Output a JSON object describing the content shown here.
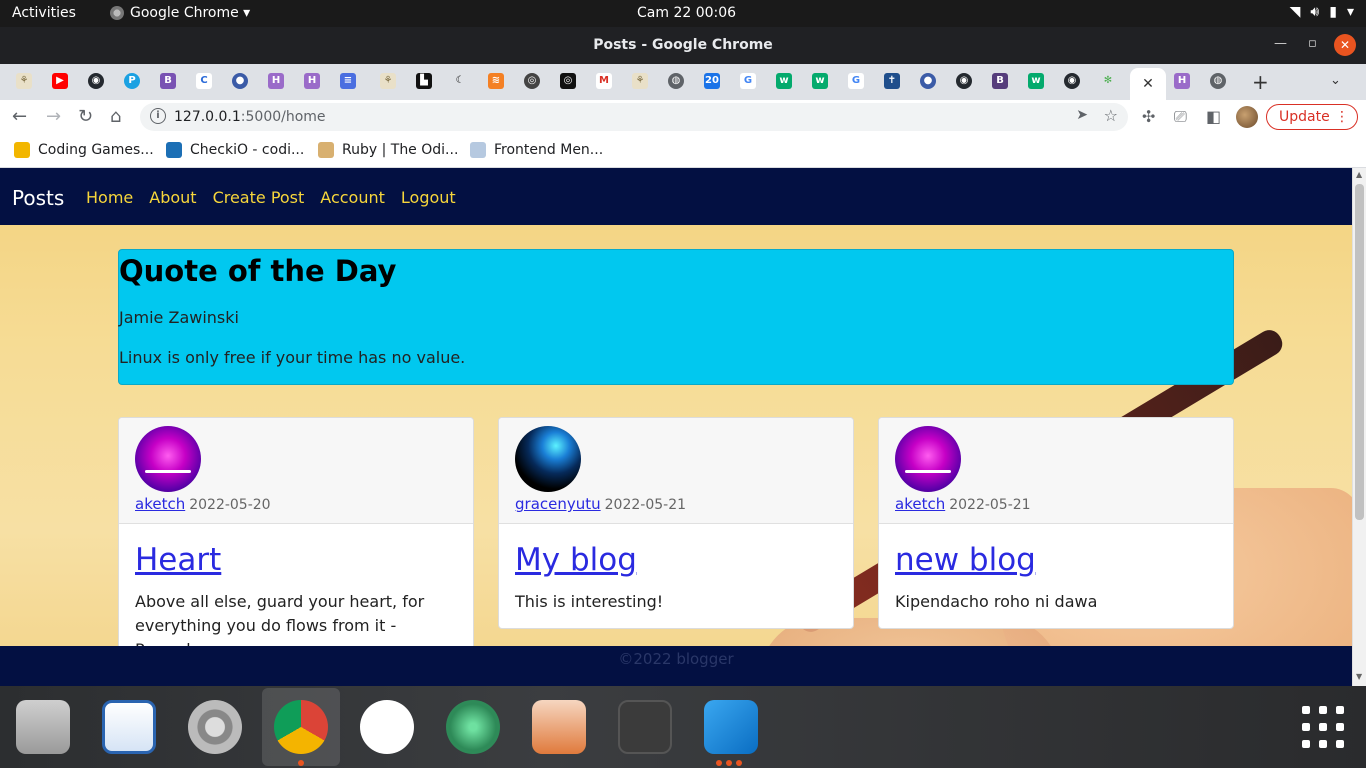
{
  "topbar": {
    "activities": "Activities",
    "app_name": "Google Chrome ▾",
    "clock": "Cam 22  00:06"
  },
  "window": {
    "title": "Posts - Google Chrome"
  },
  "address_bar": {
    "url_host": "127.0.0.1",
    "url_rest": ":5000/home",
    "update_label": "Update"
  },
  "bookmarks": [
    {
      "label": "Coding Games...",
      "color": "#f2b600"
    },
    {
      "label": "CheckiO - codi...",
      "color": "#1c6fb5"
    },
    {
      "label": "Ruby | The Odi...",
      "color": "#d8b070"
    },
    {
      "label": "Frontend Men...",
      "color": "#b6c9e0"
    }
  ],
  "page": {
    "brand": "Posts",
    "nav": [
      "Home",
      "About",
      "Create Post",
      "Account",
      "Logout"
    ],
    "quote": {
      "heading": "Quote of the Day",
      "author": "Jamie Zawinski",
      "text": "Linux is only free if your time has no value."
    },
    "posts": [
      {
        "user": "aketch",
        "date": "2022-05-20",
        "title": "Heart",
        "content": "Above all else, guard your heart, for everything you do flows from it - Proverbs"
      },
      {
        "user": "gracenyutu",
        "date": "2022-05-21",
        "title": "My blog",
        "content": "This is interesting!"
      },
      {
        "user": "aketch",
        "date": "2022-05-21",
        "title": "new blog",
        "content": "Kipendacho roho ni dawa"
      }
    ],
    "footer": "©2022 blogger"
  },
  "colors": {
    "navbar": "#031042",
    "nav_link": "#f7d63b",
    "quote_bg": "#01c8ef",
    "link": "#2a2ae0"
  }
}
